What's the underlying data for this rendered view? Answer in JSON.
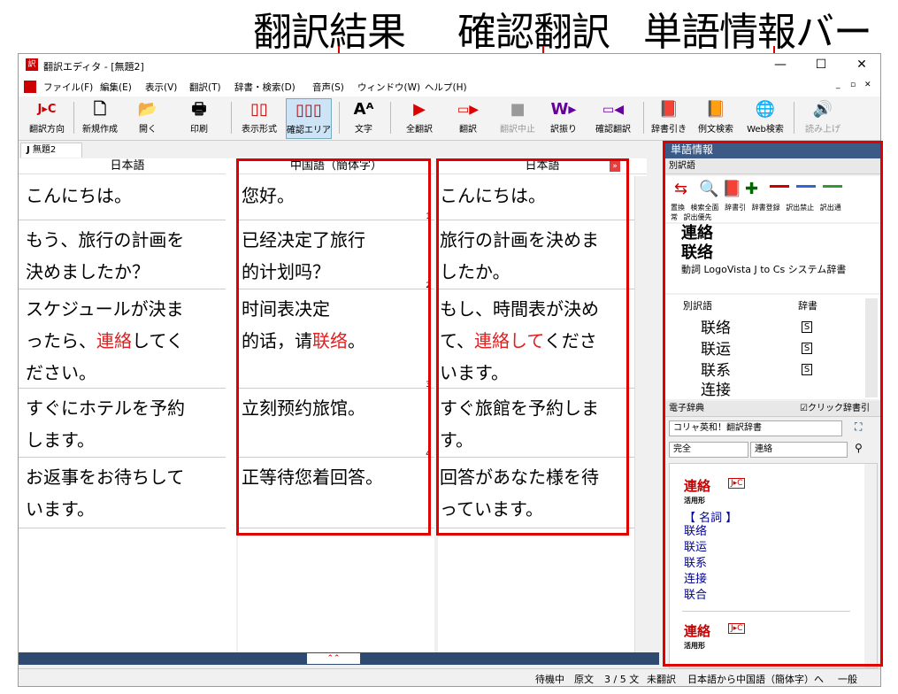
{
  "callouts": {
    "translation_result": "翻訳結果",
    "check_translation": "確認翻訳",
    "word_info_bar": "単語情報バー"
  },
  "window": {
    "title": "翻訳エディタ - [無題2]",
    "minimize": "—",
    "maximize": "☐",
    "close": "✕"
  },
  "menu": [
    "ファイル(F)",
    "編集(E)",
    "表示(V)",
    "翻訳(T)",
    "辞書・検索(D)",
    "音声(S)",
    "ウィンドウ(W)",
    "ヘルプ(H)"
  ],
  "toolbar": {
    "direction": "翻訳方向",
    "new": "新規作成",
    "open": "開く",
    "print": "印刷",
    "display_format": "表示形式",
    "check_area": "確認エリア",
    "text": "文字",
    "translate_all": "全翻訳",
    "translate": "翻訳",
    "stop": "翻訳中止",
    "furigana": "訳振り",
    "check_translate": "確認翻訳",
    "dict_lookup": "辞書引き",
    "example_search": "例文検索",
    "web_search": "Web検索",
    "read_aloud": "読み上げ",
    "direction_icon": "J▸C"
  },
  "tab": {
    "label": "無題2",
    "prefix": "J"
  },
  "panes": {
    "source_header": "日本語",
    "target_header": "中国語（簡体字）",
    "check_header": "日本語",
    "source": [
      {
        "lines": [
          "こんにちは。"
        ],
        "n": "1"
      },
      {
        "lines": [
          "もう、旅行の計画を",
          "決めましたか？"
        ],
        "n": "2"
      },
      {
        "lines": [
          "スケジュールが決ま",
          "ったら、",
          "連絡",
          "してく",
          "ださい。"
        ],
        "n": "3"
      },
      {
        "lines": [
          "すぐにホテルを予約",
          "します。"
        ],
        "n": "4"
      },
      {
        "lines": [
          "お返事をお待ちして",
          "います。"
        ],
        "n": "5"
      }
    ],
    "target": [
      {
        "lines": [
          "您好。"
        ],
        "n": "1"
      },
      {
        "lines": [
          "已经决定了旅行",
          "的计划吗？"
        ],
        "n": "2"
      },
      {
        "lines": [
          "时间表决定",
          "的话，请",
          "联络",
          "。"
        ],
        "n": "3"
      },
      {
        "lines": [
          "立刻预约旅馆。"
        ],
        "n": "4"
      },
      {
        "lines": [
          "正等待您着回答。"
        ],
        "n": ""
      }
    ],
    "check": [
      {
        "lines": [
          "こんにちは。"
        ],
        "n": "1"
      },
      {
        "lines": [
          "旅行の計画を決めま",
          "したか。"
        ],
        "n": "2"
      },
      {
        "lines": [
          "もし、時間表が決め",
          "て、",
          "連絡して",
          "くださ",
          "います。"
        ],
        "n": "3"
      },
      {
        "lines": [
          "すぐ旅館を予約しま",
          "す。"
        ],
        "n": "4"
      },
      {
        "lines": [
          "回答があなた様を待",
          "っています。"
        ],
        "n": "5"
      }
    ]
  },
  "word_info": {
    "title": "単語情報",
    "alt_section": "別訳語",
    "tools": [
      "置換",
      "検索全面",
      "辞書引",
      "辞書登録",
      "訳出禁止",
      "訳出通常",
      "訳出優先"
    ],
    "headword": "連絡",
    "translation": "联络",
    "pos": "動詞",
    "dict_name": "LogoVista J to Cs システム辞書",
    "alt_header": "別訳語",
    "dict_header": "辞書",
    "alternatives": [
      "联络",
      "联运",
      "联系",
      "连接"
    ],
    "edict_title": "電子辞典",
    "click_lookup": "☑クリック辞書引",
    "dict_select": "コリャ英和！翻訳辞書",
    "match_mode": "完全",
    "search_value": "連絡",
    "entry_word": "連絡",
    "entry_badge": "J▸C",
    "inflection": "活用形",
    "noun_label": "【 名詞 】",
    "senses": [
      "联络",
      "联运",
      "联系",
      "连接",
      "联合"
    ],
    "entry_word2": "連絡",
    "inflection2": "活用形"
  },
  "status": [
    "待機中",
    "原文",
    "3 / 5 文",
    "未翻訳",
    "日本語から中国語（簡体字）へ",
    "一般"
  ]
}
